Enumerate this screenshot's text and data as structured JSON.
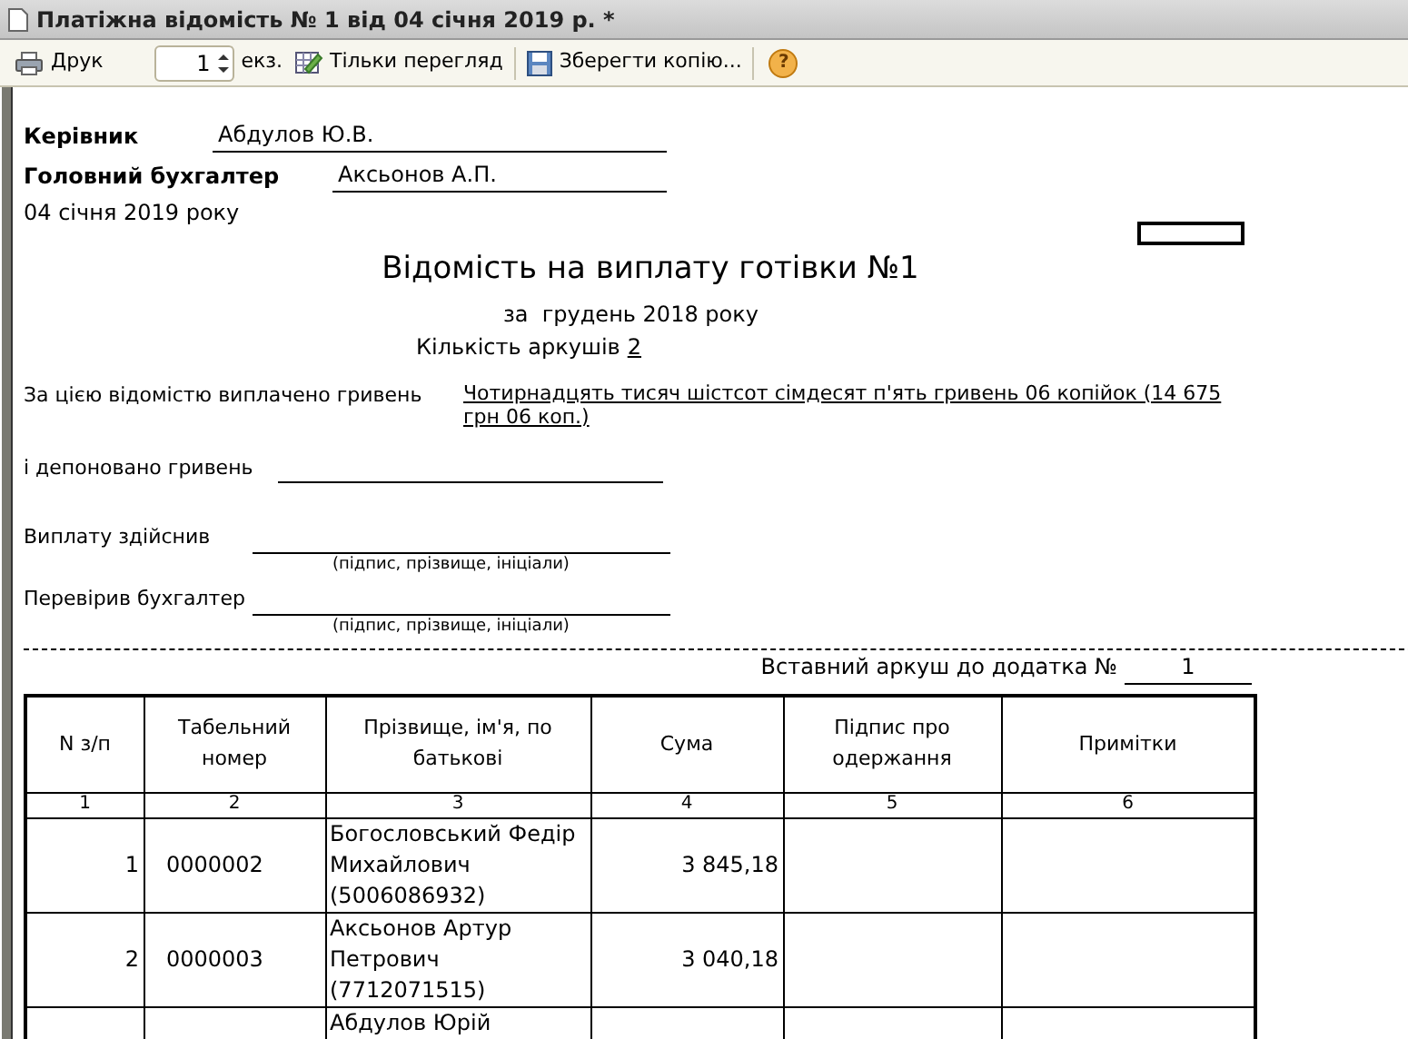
{
  "window": {
    "title": "Платіжна відомість № 1 від 04 січня 2019 р. *"
  },
  "toolbar": {
    "print": "Друк",
    "copies": "1",
    "copies_unit": "екз.",
    "view_only": "Тільки перегляд",
    "save_copy": "Зберегти копію...",
    "help": "?"
  },
  "document": {
    "signatures": [
      {
        "label": "Керівник",
        "name": "Абдулов Ю.В."
      },
      {
        "label": "Головний бухгалтер",
        "name": "Аксьонов А.П."
      }
    ],
    "date": "04 січня 2019 року",
    "title": "Відомість на виплату готівки №1",
    "period": "за  грудень 2018 року",
    "sheets_label": "Кількість аркушів",
    "sheets": "2",
    "paid_label": "За цією відомістю виплачено гривень",
    "paid_amount": "Чотирнадцять тисяч шістсот сімдесят п'ять гривень 06 копійок (14 675 грн 06 коп.)",
    "deposited_label": "і депоновано гривень",
    "sign_lines": [
      {
        "label": "Виплату здійснив",
        "hint": "(підпис, прізвище, ініціали)"
      },
      {
        "label": "Перевірив бухгалтер",
        "hint": "(підпис, прізвище, ініціали)"
      }
    ],
    "insert_sheet_label": "Вставний аркуш до додатка №",
    "insert_sheet_number": "1"
  },
  "table": {
    "columns": [
      {
        "label": "N з/п",
        "number": "1"
      },
      {
        "label": "Табельний номер",
        "number": "2"
      },
      {
        "label": "Прізвище, ім'я, по батькові",
        "number": "3"
      },
      {
        "label": "Сума",
        "number": "4"
      },
      {
        "label": "Підпис про одержання",
        "number": "5"
      },
      {
        "label": "Примітки",
        "number": "6"
      }
    ],
    "rows": [
      {
        "no": "1",
        "tab_no": "0000002",
        "name": "Богословський Федір Михайлович (5006086932)",
        "amount": "3 845,18"
      },
      {
        "no": "2",
        "tab_no": "0000003",
        "name": "Аксьонов Артур Петрович (7712071515)",
        "amount": "3 040,18"
      },
      {
        "name": "Абдулов Юрій"
      }
    ]
  }
}
